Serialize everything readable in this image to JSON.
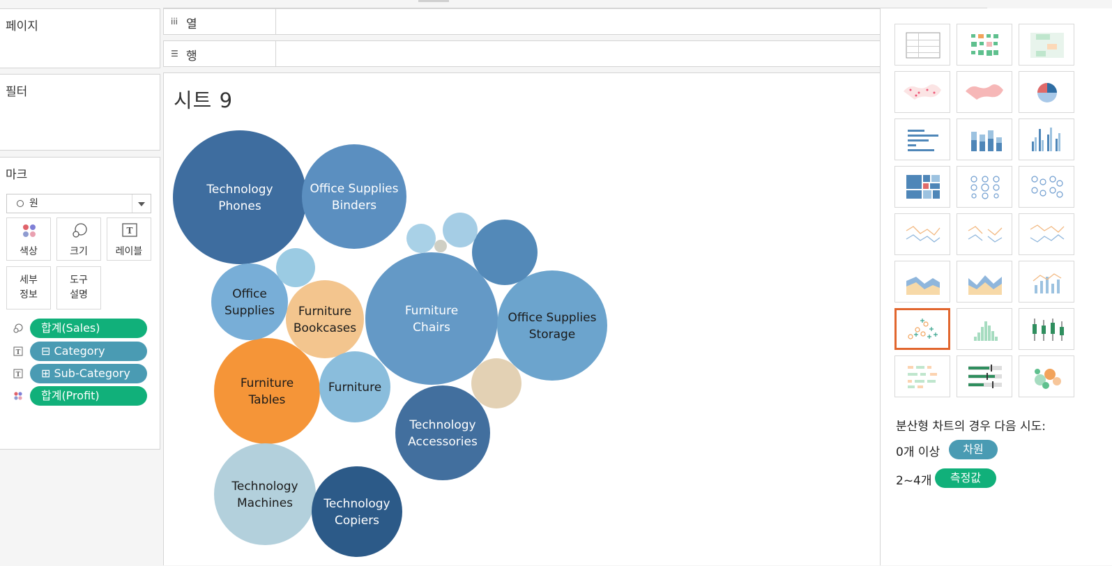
{
  "panels": {
    "pages": "페이지",
    "filters": "필터",
    "marks": "마크"
  },
  "shelves": {
    "columns": "열",
    "rows": "행"
  },
  "marks": {
    "mark_type": "원",
    "buttons": {
      "color": "색상",
      "size": "크기",
      "label": "레이블",
      "detail": "세부\n정보",
      "tooltip": "도구\n설명"
    },
    "pills": [
      {
        "text": "합계(Sales)",
        "role": "size",
        "kind": "measure"
      },
      {
        "text": "⊟ Category",
        "role": "label",
        "kind": "dimension"
      },
      {
        "text": "⊞ Sub-Category",
        "role": "label",
        "kind": "dimension"
      },
      {
        "text": "합계(Profit)",
        "role": "color",
        "kind": "measure"
      }
    ]
  },
  "sheet": {
    "title": "시트 9"
  },
  "chart_data": {
    "type": "packed-bubble",
    "size_measure": "합계(Sales)",
    "color_measure": "합계(Profit)",
    "bubbles": [
      {
        "label": "Technology\nPhones",
        "size_rank": 1,
        "color": "#3e6d9f",
        "text": "#ffffff"
      },
      {
        "label": "Furniture\nChairs",
        "size_rank": 2,
        "color": "#6499c6",
        "text": "#ffffff"
      },
      {
        "label": "Office Supplies\nStorage",
        "size_rank": 3,
        "color": "#6ca4cd",
        "text": "#1a1a1a"
      },
      {
        "label": "Furniture\nTables",
        "size_rank": 4,
        "color": "#f59538",
        "text": "#1a1a1a"
      },
      {
        "label": "Office Supplies\nBinders",
        "size_rank": 5,
        "color": "#5b8fc0",
        "text": "#ffffff"
      },
      {
        "label": "Technology\nMachines",
        "size_rank": 6,
        "color": "#b3d0dc",
        "text": "#1a1a1a"
      },
      {
        "label": "Technology\nAccessories",
        "size_rank": 7,
        "color": "#426f9e",
        "text": "#ffffff"
      },
      {
        "label": "Technology\nCopiers",
        "size_rank": 8,
        "color": "#2c5a88",
        "text": "#ffffff"
      },
      {
        "label": "Furniture\nBookcases",
        "size_rank": 9,
        "color": "#f3c58e",
        "text": "#1a1a1a"
      },
      {
        "label": "Office\nSupplies",
        "size_rank": 10,
        "color": "#78aed7",
        "text": "#1a1a1a"
      },
      {
        "label": "Furniture",
        "size_rank": 11,
        "color": "#8abddc",
        "text": "#1a1a1a"
      },
      {
        "label": "",
        "size_rank": 12,
        "color": "#5389b8",
        "text": "#ffffff"
      },
      {
        "label": "",
        "size_rank": 13,
        "color": "#e3d1b4",
        "text": "#1a1a1a"
      },
      {
        "label": "",
        "size_rank": 14,
        "color": "#9bcbe3",
        "text": "#1a1a1a"
      },
      {
        "label": "",
        "size_rank": 15,
        "color": "#a5cde5",
        "text": "#1a1a1a"
      },
      {
        "label": "",
        "size_rank": 16,
        "color": "#a9d1e7",
        "text": "#1a1a1a"
      },
      {
        "label": "",
        "size_rank": 17,
        "color": "#cfcfc4",
        "text": "#1a1a1a"
      }
    ]
  },
  "show_me": {
    "charts": [
      "text-table",
      "heat-map",
      "highlight-table",
      "symbol-map",
      "filled-map",
      "pie-chart",
      "horizontal-bars",
      "stacked-bars",
      "side-by-side-bars",
      "treemap",
      "circle-view",
      "side-by-side-circles",
      "line-continuous",
      "line-discrete",
      "dual-lines",
      "area-continuous",
      "area-discrete",
      "dual-combination",
      "scatter-plot",
      "histogram",
      "box-whisker",
      "gantt-chart",
      "bullet-graph",
      "packed-bubbles"
    ],
    "selected": "scatter-plot",
    "hint_title": "분산형 차트의 경우 다음 시도:",
    "hint_dim_prefix": "0개 이상",
    "hint_dim_pill": "차원",
    "hint_mea_prefix": "2~4개",
    "hint_mea_pill": "측정값"
  },
  "colors": {
    "measure_pill": "#11b07a",
    "dimension_pill": "#4a9bb3",
    "selected_border": "#e1662e"
  }
}
